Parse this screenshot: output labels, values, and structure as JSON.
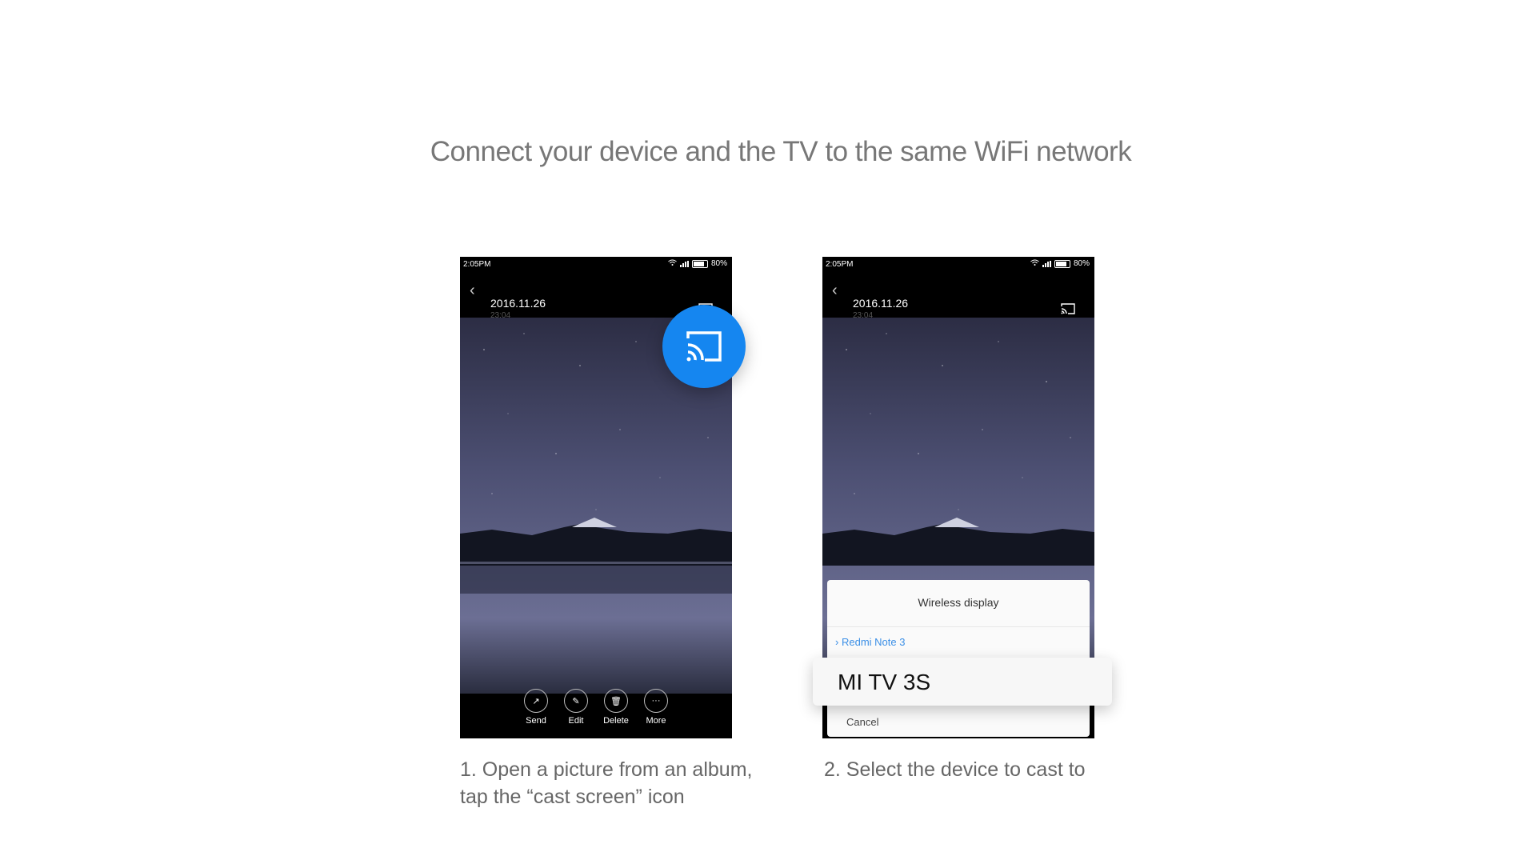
{
  "headline": "Connect your device and the TV to the same WiFi network",
  "status": {
    "time": "2:05PM",
    "battery": "80%"
  },
  "photo": {
    "date": "2016.11.26",
    "time": "23:04"
  },
  "toolbar": [
    {
      "label": "Send",
      "icon": "send-icon",
      "glyph": "↗"
    },
    {
      "label": "Edit",
      "icon": "edit-icon",
      "glyph": "✎"
    },
    {
      "label": "Delete",
      "icon": "delete-icon",
      "glyph": "🗑"
    },
    {
      "label": "More",
      "icon": "more-icon",
      "glyph": "···"
    }
  ],
  "dialog": {
    "title": "Wireless display",
    "option1": "Redmi Note 3",
    "highlight": "MI TV 3S",
    "cancel": "Cancel"
  },
  "captions": {
    "step1": "1. Open a picture from an album, tap the “cast screen” icon",
    "step2": "2. Select the device to cast to"
  },
  "colors": {
    "accent": "#1586f0",
    "link": "#3b8fe6"
  }
}
